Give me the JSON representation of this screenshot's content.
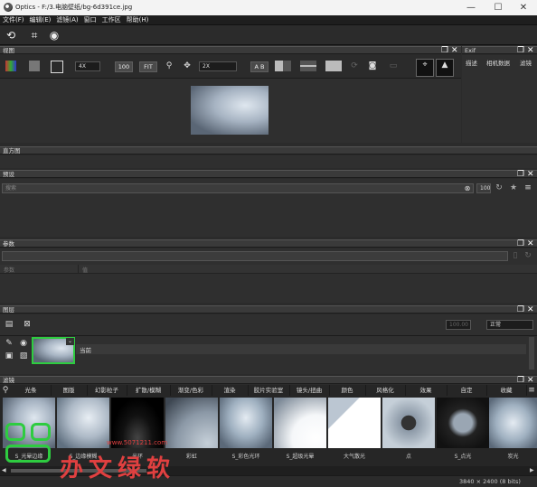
{
  "window": {
    "title": "Optics - F:/3.电脑壁纸/bg-6d391ce.jpg",
    "min": "—",
    "max": "☐",
    "close": "✕"
  },
  "menu": [
    "文件(F)",
    "编辑(E)",
    "滤镜(A)",
    "窗口",
    "工作区",
    "帮助(H)"
  ],
  "view_panel": {
    "title": "视图",
    "zoom_value": "4X",
    "size_btn": "100",
    "fit_btn": "FIT",
    "zoom_select": "2X",
    "ab_btn": "A B"
  },
  "exif_panel": {
    "title": "Exif",
    "tabs": [
      "描述",
      "相机数据",
      "滤镜"
    ]
  },
  "histogram_panel": {
    "title": "直方图"
  },
  "presets_panel": {
    "title": "预设",
    "search_placeholder": "搜索",
    "amount": "100"
  },
  "params_panel": {
    "title": "参数",
    "col1": "参数",
    "col2": "值"
  },
  "layers_panel": {
    "title": "图层",
    "opacity": "100.00",
    "blend_mode": "正常",
    "layer_name": "当前"
  },
  "filters_panel": {
    "title": "滤镜",
    "tabs": [
      "光条",
      "图版",
      "幻影粒子",
      "扩散/模糊",
      "渐变/色彩",
      "渲染",
      "胶片实验室",
      "镜头/扭曲",
      "颜色",
      "风格化",
      "效果",
      "自定",
      "收藏"
    ],
    "thumbs": [
      "S_光晕边缘",
      "S_边缘模糊",
      "光环",
      "彩虹",
      "S_彩色光环",
      "S_超级光晕",
      "大气散光",
      "点",
      "S_点光",
      "炭光"
    ]
  },
  "status": {
    "dims": "3840 × 2400 (8 bits)"
  },
  "watermark": {
    "url": "www.5071211.com",
    "text": "办文绿软"
  }
}
